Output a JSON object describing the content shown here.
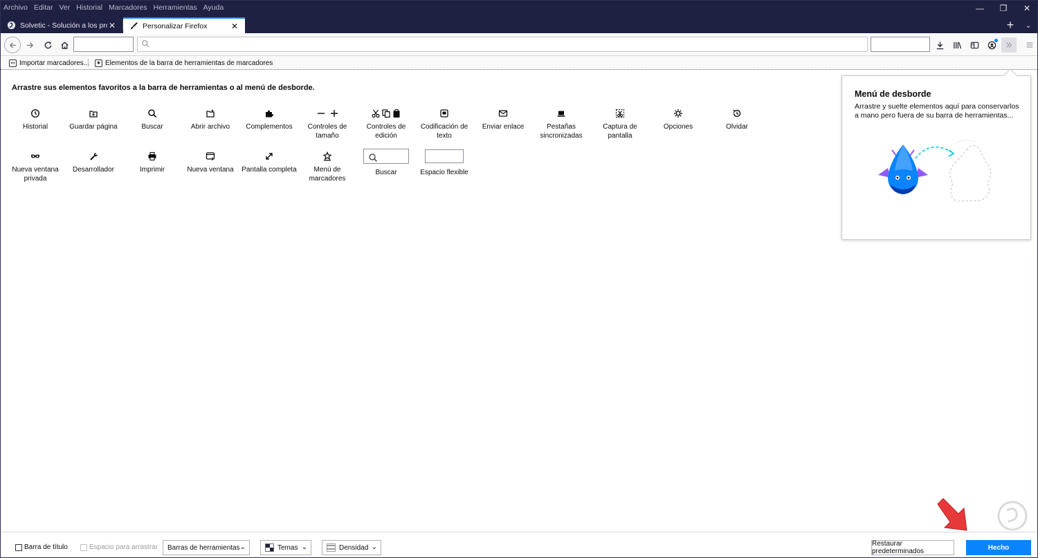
{
  "menubar": {
    "items": [
      "Archivo",
      "Editar",
      "Ver",
      "Historial",
      "Marcadores",
      "Herramientas",
      "Ayuda"
    ]
  },
  "tabs": [
    {
      "label": "Solvetic - Solución a los proble",
      "icon": "solvetic-favicon"
    },
    {
      "label": "Personalizar Firefox",
      "icon": "paintbrush-icon"
    }
  ],
  "bookmarks": {
    "import_label": "Importar marcadores...",
    "toolbar_items_label": "Elementos de la barra de herramientas de marcadores"
  },
  "palette": {
    "title": "Arrastre sus elementos favoritos a la barra de herramientas o al menú de desborde.",
    "items": [
      {
        "label": "Historial",
        "icon": "clock-icon"
      },
      {
        "label": "Guardar página",
        "icon": "save-page-icon"
      },
      {
        "label": "Buscar",
        "icon": "search-icon"
      },
      {
        "label": "Abrir archivo",
        "icon": "open-file-icon"
      },
      {
        "label": "Complementos",
        "icon": "puzzle-icon"
      },
      {
        "label": "Controles de tamaño",
        "icon": "zoom-controls-icon"
      },
      {
        "label": "Controles de edición",
        "icon": "edit-controls-icon"
      },
      {
        "label": "Codificación de texto",
        "icon": "text-encoding-icon"
      },
      {
        "label": "Enviar enlace",
        "icon": "mail-icon"
      },
      {
        "label": "Pestañas sincronizadas",
        "icon": "synced-tabs-icon"
      },
      {
        "label": "Captura de pantalla",
        "icon": "screenshot-icon"
      },
      {
        "label": "Opciones",
        "icon": "gear-icon"
      },
      {
        "label": "Olvidar",
        "icon": "forget-icon"
      },
      {
        "label": "Nueva ventana privada",
        "icon": "private-mask-icon"
      },
      {
        "label": "Desarrollador",
        "icon": "wrench-icon"
      },
      {
        "label": "Imprimir",
        "icon": "printer-icon"
      },
      {
        "label": "Nueva ventana",
        "icon": "new-window-icon"
      },
      {
        "label": "Pantalla completa",
        "icon": "fullscreen-icon"
      },
      {
        "label": "Menú de marcadores",
        "icon": "bookmark-star-icon"
      },
      {
        "label": "Buscar",
        "icon": "search-box-icon"
      },
      {
        "label": "Espacio flexible",
        "icon": "flexible-space-icon"
      }
    ]
  },
  "overflow_panel": {
    "title": "Menú de desborde",
    "description": "Arrastre y suelte elementos aquí para conservarlos a mano pero fuera de su barra de herramientas..."
  },
  "footer": {
    "title_bar_label": "Barra de título",
    "drag_space_label": "Espacio para arrastrar",
    "toolbars_label": "Barras de herramientas",
    "themes_label": "Temas",
    "density_label": "Densidad",
    "restore_label": "Restaurar predeterminados",
    "done_label": "Hecho"
  },
  "colors": {
    "titlebar": "#1f2142",
    "accent": "#0a84ff",
    "annotation_arrow": "#e8393a"
  }
}
